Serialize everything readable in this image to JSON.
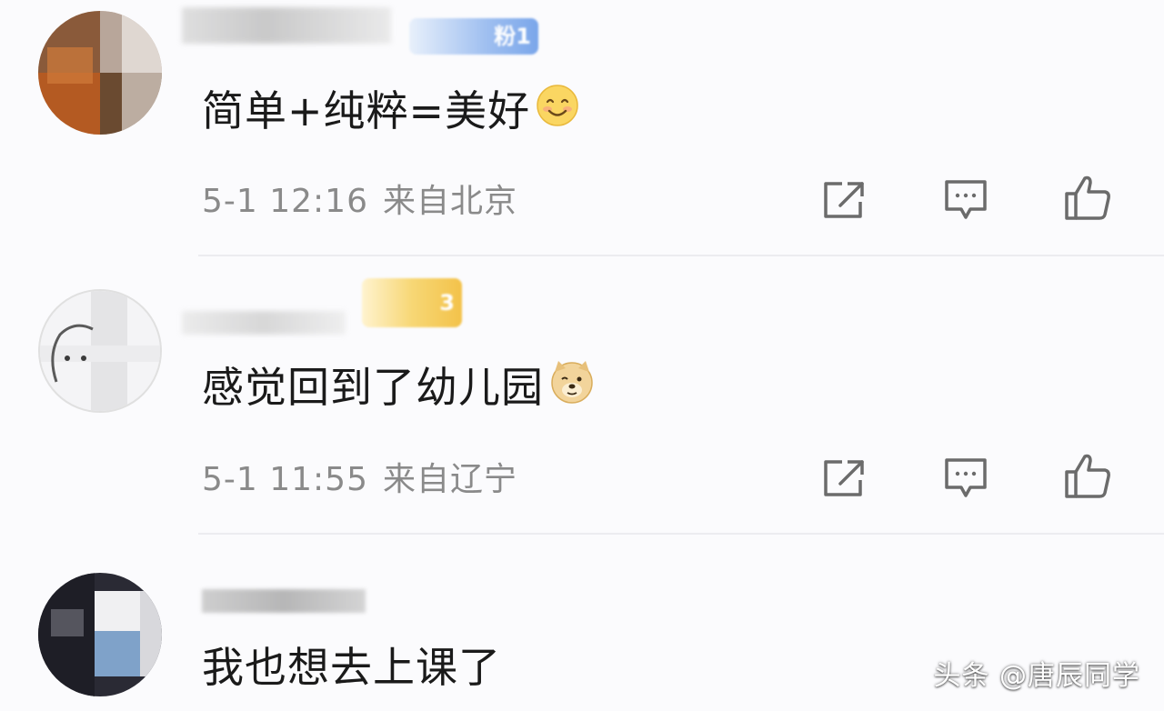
{
  "comments": [
    {
      "username": "",
      "badge": "粉1",
      "text": "简单+纯粹=美好",
      "emoji": "smile-emoji",
      "time": "5-1 12:16",
      "location": "来自北京"
    },
    {
      "username": "",
      "badge": "3",
      "text": "感觉回到了幼儿园",
      "emoji": "doge-emoji",
      "time": "5-1 11:55",
      "location": "来自辽宁"
    },
    {
      "username": "",
      "badge": "",
      "text": "我也想去上课了",
      "emoji": "",
      "time": "",
      "location": ""
    }
  ],
  "actions": {
    "share_icon": "share-icon",
    "reply_icon": "reply-icon",
    "like_icon": "like-icon"
  },
  "watermark": "头条 @唐辰同学",
  "colors": {
    "background": "#fbfbfd",
    "text": "#1a1a1a",
    "meta": "#8a8a8a",
    "icon": "#6b6b6b",
    "fan_badge": "#7aa6ea",
    "level_badge": "#f3cc5a"
  }
}
